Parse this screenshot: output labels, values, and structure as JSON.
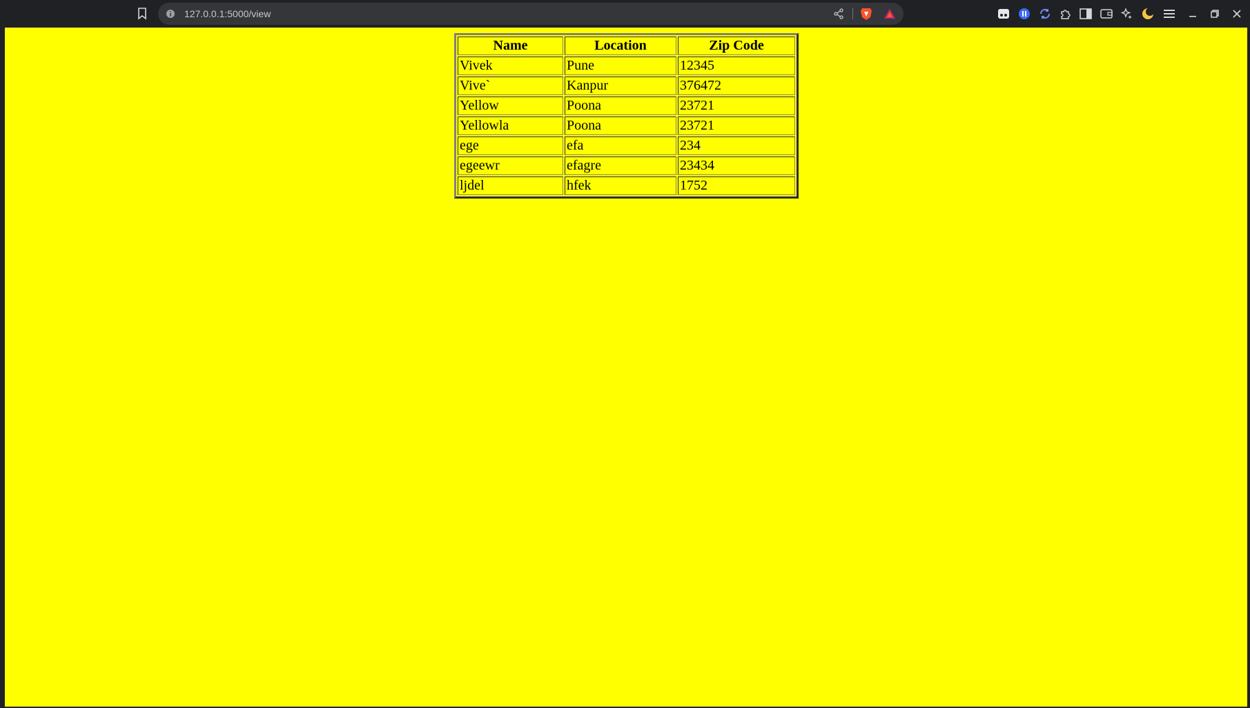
{
  "browser": {
    "url": "127.0.0.1:5000/view",
    "icons": [
      "bookmark-icon",
      "info-icon",
      "share-icon",
      "brave-shield-icon",
      "brave-rewards-icon",
      "reader-icon",
      "pause-icon",
      "sync-icon",
      "extensions-icon",
      "sidebar-icon",
      "wallet-icon",
      "leo-icon",
      "night-icon",
      "menu-icon",
      "minimize-icon",
      "restore-icon",
      "close-icon"
    ],
    "colors": {
      "chrome": "#202124",
      "omnibox": "#35363a",
      "page_bg": "#ffff00"
    }
  },
  "table": {
    "headers": [
      "Name",
      "Location",
      "Zip Code"
    ],
    "rows": [
      [
        "Vivek",
        "Pune",
        "12345"
      ],
      [
        "Vive`",
        "Kanpur",
        "376472"
      ],
      [
        "Yellow",
        "Poona",
        "23721"
      ],
      [
        "Yellowla",
        "Poona",
        "23721"
      ],
      [
        "ege",
        "efa",
        "234"
      ],
      [
        "egeewr",
        "efagre",
        "23434"
      ],
      [
        "ljdel",
        "hfek",
        "1752"
      ]
    ]
  }
}
